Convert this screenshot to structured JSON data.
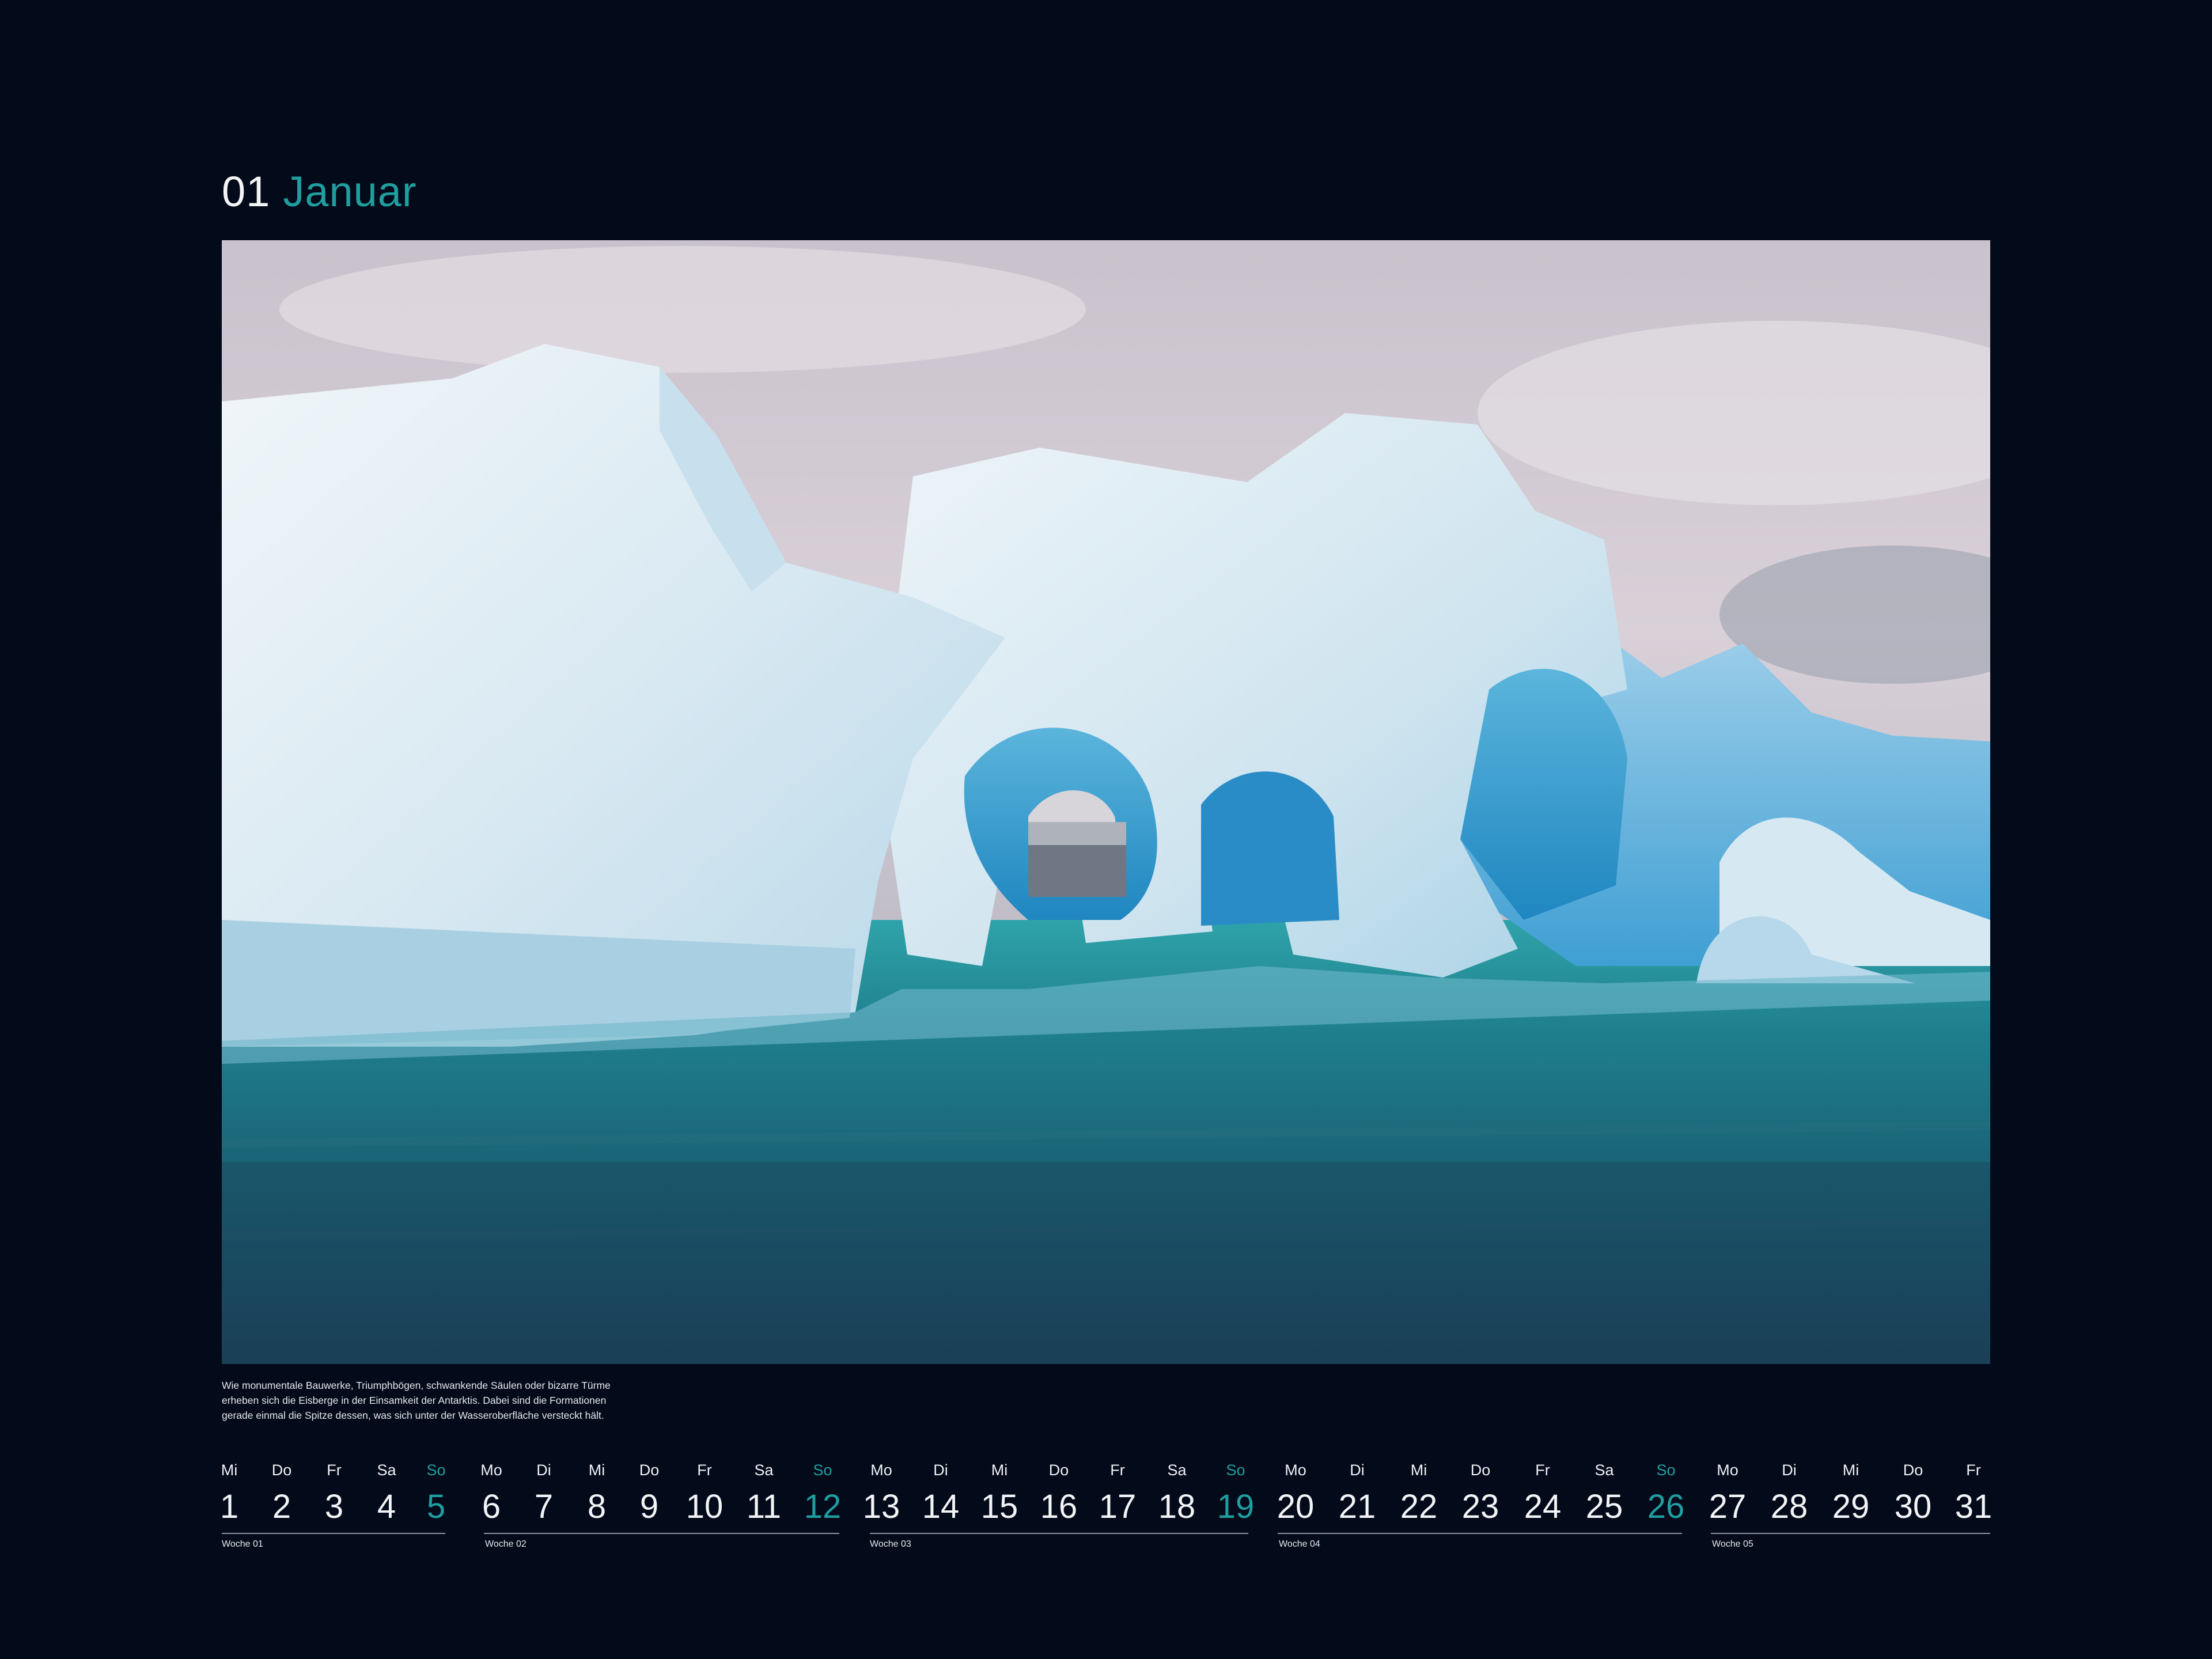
{
  "header": {
    "month_number": "01",
    "month_name": "Januar"
  },
  "caption": {
    "lines": [
      "Wie monumentale Bauwerke, Triumphbögen, schwankende Säulen oder bizarre Türme",
      "erheben sich die Eisberge in der Einsamkeit der Antarktis. Dabei sind die Formationen",
      "gerade einmal die Spitze dessen, was sich unter der Wasseroberfläche versteckt hält."
    ]
  },
  "colors": {
    "background": "#030a1a",
    "accent_sunday": "#1f9ea0",
    "text": "#f2f4f6"
  },
  "weeks": [
    {
      "label": "Woche 01",
      "days": [
        {
          "name": "Mi",
          "num": "1"
        },
        {
          "name": "Do",
          "num": "2"
        },
        {
          "name": "Fr",
          "num": "3"
        },
        {
          "name": "Sa",
          "num": "4"
        },
        {
          "name": "So",
          "num": "5"
        }
      ]
    },
    {
      "label": "Woche 02",
      "days": [
        {
          "name": "Mo",
          "num": "6"
        },
        {
          "name": "Di",
          "num": "7"
        },
        {
          "name": "Mi",
          "num": "8"
        },
        {
          "name": "Do",
          "num": "9"
        },
        {
          "name": "Fr",
          "num": "10"
        },
        {
          "name": "Sa",
          "num": "11"
        },
        {
          "name": "So",
          "num": "12"
        }
      ]
    },
    {
      "label": "Woche 03",
      "days": [
        {
          "name": "Mo",
          "num": "13"
        },
        {
          "name": "Di",
          "num": "14"
        },
        {
          "name": "Mi",
          "num": "15"
        },
        {
          "name": "Do",
          "num": "16"
        },
        {
          "name": "Fr",
          "num": "17"
        },
        {
          "name": "Sa",
          "num": "18"
        },
        {
          "name": "So",
          "num": "19"
        }
      ]
    },
    {
      "label": "Woche 04",
      "days": [
        {
          "name": "Mo",
          "num": "20"
        },
        {
          "name": "Di",
          "num": "21"
        },
        {
          "name": "Mi",
          "num": "22"
        },
        {
          "name": "Do",
          "num": "23"
        },
        {
          "name": "Fr",
          "num": "24"
        },
        {
          "name": "Sa",
          "num": "25"
        },
        {
          "name": "So",
          "num": "26"
        }
      ]
    },
    {
      "label": "Woche 05",
      "days": [
        {
          "name": "Mo",
          "num": "27"
        },
        {
          "name": "Di",
          "num": "28"
        },
        {
          "name": "Mi",
          "num": "29"
        },
        {
          "name": "Do",
          "num": "30"
        },
        {
          "name": "Fr",
          "num": "31"
        }
      ]
    }
  ]
}
